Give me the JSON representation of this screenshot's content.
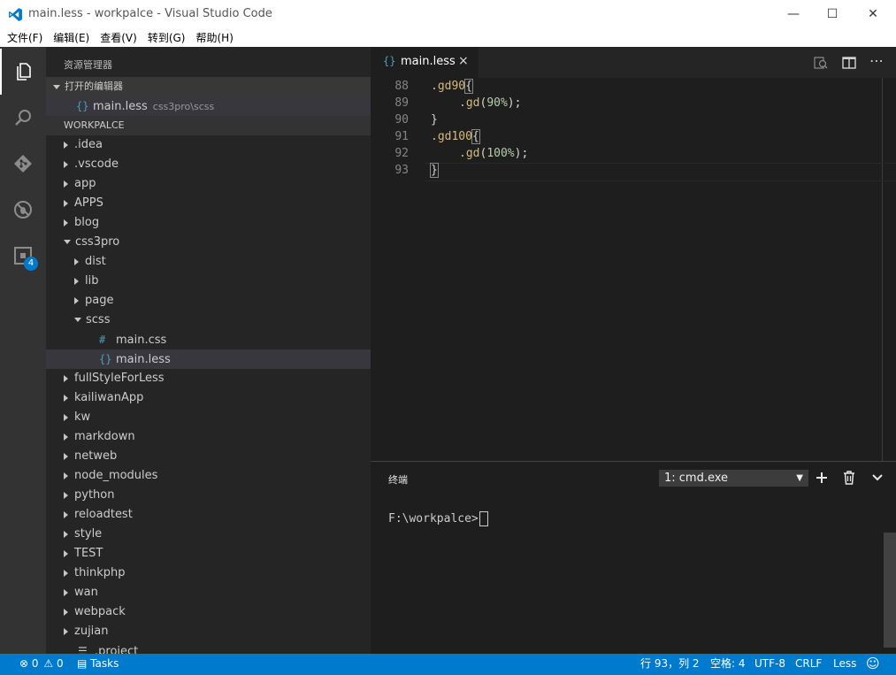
{
  "window": {
    "title": "main.less - workpalce - Visual Studio Code",
    "minimize": "—",
    "maximize": "☐",
    "close": "✕"
  },
  "menu": [
    "文件(F)",
    "编辑(E)",
    "查看(V)",
    "转到(G)",
    "帮助(H)"
  ],
  "activity": {
    "icons": [
      "explorer-icon",
      "search-icon",
      "git-icon",
      "debug-icon",
      "extensions-icon"
    ],
    "extensions_badge": "4"
  },
  "explorer": {
    "title": "资源管理器",
    "open_editors_label": "打开的编辑器",
    "open_editors": [
      {
        "icon": "{}",
        "name": "main.less",
        "path": "css3pro\\scss"
      }
    ],
    "workspace_label": "WORKPALCE",
    "tree": [
      {
        "name": ".idea",
        "depth": 0,
        "kind": "folder",
        "expanded": false
      },
      {
        "name": ".vscode",
        "depth": 0,
        "kind": "folder",
        "expanded": false
      },
      {
        "name": "app",
        "depth": 0,
        "kind": "folder",
        "expanded": false
      },
      {
        "name": "APPS",
        "depth": 0,
        "kind": "folder",
        "expanded": false
      },
      {
        "name": "blog",
        "depth": 0,
        "kind": "folder",
        "expanded": false
      },
      {
        "name": "css3pro",
        "depth": 0,
        "kind": "folder",
        "expanded": true
      },
      {
        "name": "dist",
        "depth": 1,
        "kind": "folder",
        "expanded": false
      },
      {
        "name": "lib",
        "depth": 1,
        "kind": "folder",
        "expanded": false
      },
      {
        "name": "page",
        "depth": 1,
        "kind": "folder",
        "expanded": false
      },
      {
        "name": "scss",
        "depth": 1,
        "kind": "folder",
        "expanded": true
      },
      {
        "name": "main.css",
        "depth": 2,
        "kind": "file",
        "icon": "#"
      },
      {
        "name": "main.less",
        "depth": 2,
        "kind": "file",
        "icon": "{}",
        "selected": true
      },
      {
        "name": "fullStyleForLess",
        "depth": 0,
        "kind": "folder",
        "expanded": false
      },
      {
        "name": "kailiwanApp",
        "depth": 0,
        "kind": "folder",
        "expanded": false
      },
      {
        "name": "kw",
        "depth": 0,
        "kind": "folder",
        "expanded": false
      },
      {
        "name": "markdown",
        "depth": 0,
        "kind": "folder",
        "expanded": false
      },
      {
        "name": "netweb",
        "depth": 0,
        "kind": "folder",
        "expanded": false
      },
      {
        "name": "node_modules",
        "depth": 0,
        "kind": "folder",
        "expanded": false
      },
      {
        "name": "python",
        "depth": 0,
        "kind": "folder",
        "expanded": false
      },
      {
        "name": "reloadtest",
        "depth": 0,
        "kind": "folder",
        "expanded": false
      },
      {
        "name": "style",
        "depth": 0,
        "kind": "folder",
        "expanded": false
      },
      {
        "name": "TEST",
        "depth": 0,
        "kind": "folder",
        "expanded": false
      },
      {
        "name": "thinkphp",
        "depth": 0,
        "kind": "folder",
        "expanded": false
      },
      {
        "name": "wan",
        "depth": 0,
        "kind": "folder",
        "expanded": false
      },
      {
        "name": "webpack",
        "depth": 0,
        "kind": "folder",
        "expanded": false
      },
      {
        "name": "zujian",
        "depth": 0,
        "kind": "folder",
        "expanded": false
      },
      {
        "name": ".project",
        "depth": 0,
        "kind": "file",
        "icon": "☰"
      }
    ]
  },
  "tab": {
    "icon": "{}",
    "label": "main.less",
    "close": "×"
  },
  "editor": {
    "lines": [
      {
        "no": "88",
        "sel": ".gd90",
        "open": "{",
        "indent": false
      },
      {
        "no": "89",
        "fn": ".gd",
        "arg": "90%",
        "indent": true
      },
      {
        "no": "90",
        "close": "}",
        "indent": false
      },
      {
        "no": "91",
        "sel": ".gd100",
        "open": "{",
        "indent": false
      },
      {
        "no": "92",
        "fn": ".gd",
        "arg": "100%",
        "indent": true
      },
      {
        "no": "93",
        "close": "}",
        "indent": false,
        "current": true
      }
    ]
  },
  "panel": {
    "title": "终端",
    "terminal_select": "1: cmd.exe",
    "prompt": "F:\\workpalce>"
  },
  "status": {
    "errors": "0",
    "warnings": "0",
    "tasks": "Tasks",
    "position": "行 93，列 2",
    "spaces": "空格: 4",
    "encoding": "UTF-8",
    "eol": "CRLF",
    "language": "Less"
  }
}
